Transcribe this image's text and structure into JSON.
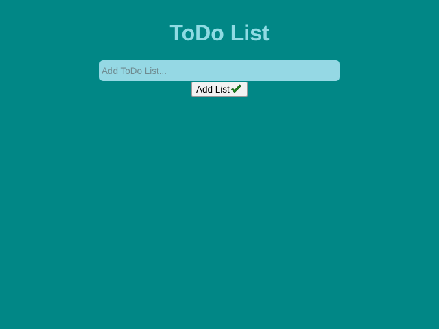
{
  "page": {
    "title": "ToDo List"
  },
  "form": {
    "input_value": "",
    "input_placeholder": "Add ToDo List...",
    "add_button_label": "Add List",
    "add_button_icon": "check-icon"
  },
  "colors": {
    "background": "#018786",
    "title": "#8fdbe3",
    "input_background": "#95d8e4",
    "check_icon": "#1f8a1f"
  }
}
